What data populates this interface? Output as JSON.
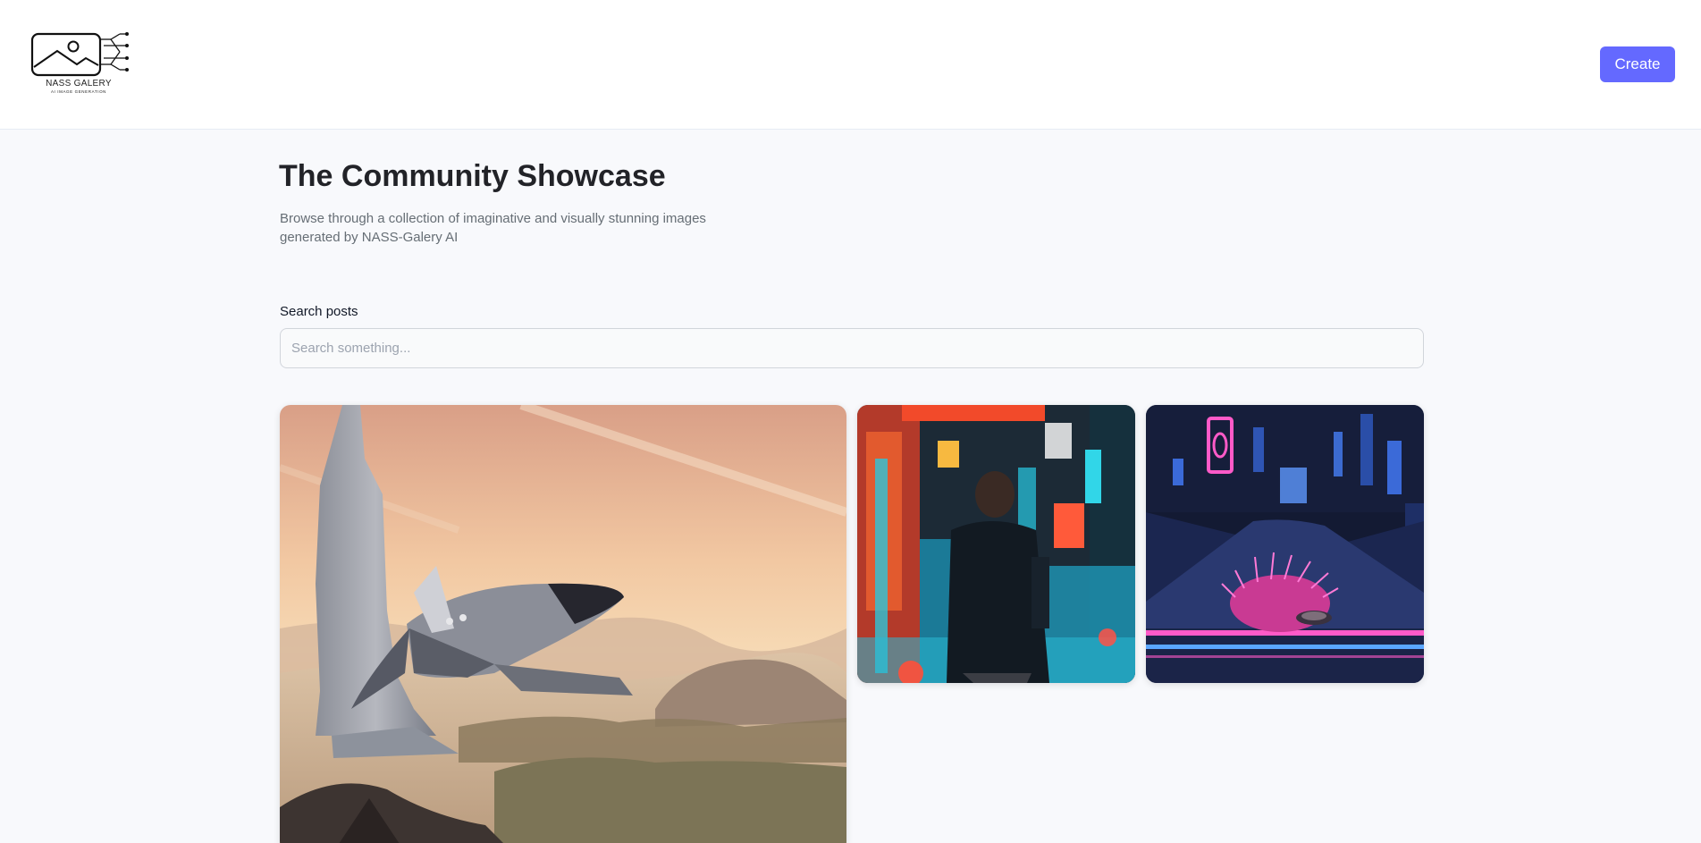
{
  "header": {
    "logo": {
      "name": "NASS GALERY",
      "tagline": "AI IMAGE GENERATION"
    },
    "create_label": "Create"
  },
  "main": {
    "title": "The Community Showcase",
    "subtitle": "Browse through a collection of imaginative and visually stunning images generated by NASS-Galery AI",
    "search": {
      "label": "Search posts",
      "placeholder": "Search something...",
      "value": ""
    }
  },
  "colors": {
    "accent": "#6469ff",
    "background": "#f8f9fc",
    "header_background": "#ffffff",
    "title": "#222328",
    "subtitle": "#666e75"
  }
}
